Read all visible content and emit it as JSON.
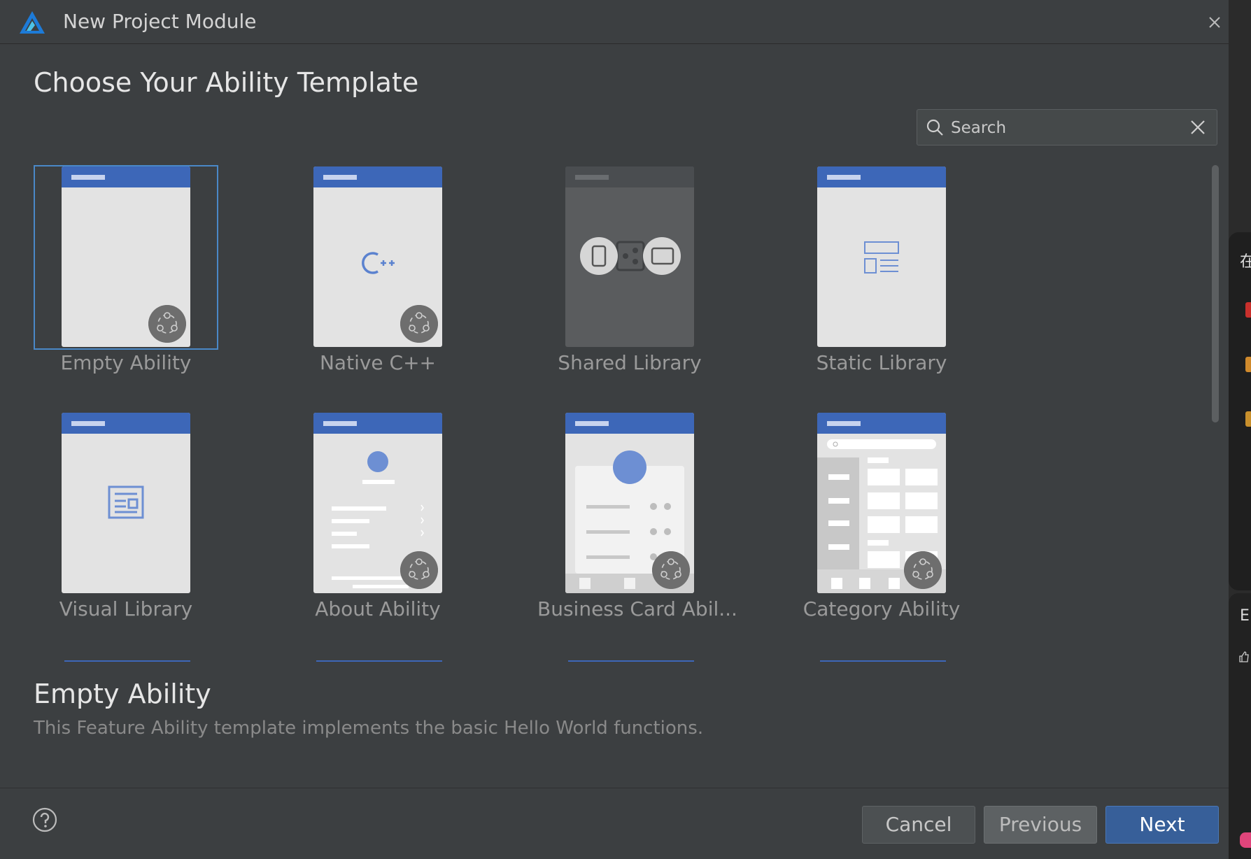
{
  "window": {
    "title": "New Project Module"
  },
  "heading": "Choose Your Ability Template",
  "search": {
    "placeholder": "Search"
  },
  "templates": [
    {
      "label": "Empty Ability"
    },
    {
      "label": "Native C++"
    },
    {
      "label": "Shared Library"
    },
    {
      "label": "Static Library"
    },
    {
      "label": "Visual Library"
    },
    {
      "label": "About Ability"
    },
    {
      "label": "Business Card Abil..."
    },
    {
      "label": "Category Ability"
    }
  ],
  "selected": {
    "title": "Empty Ability",
    "description": "This Feature Ability template implements the basic Hello World functions."
  },
  "buttons": {
    "cancel": "Cancel",
    "previous": "Previous",
    "next": "Next"
  },
  "side": {
    "char1": "在",
    "char2": "E"
  },
  "colors": {
    "accent": "#3d67b8",
    "selection": "#4a88c7",
    "primary_button": "#375f99",
    "background": "#3c3f41"
  }
}
